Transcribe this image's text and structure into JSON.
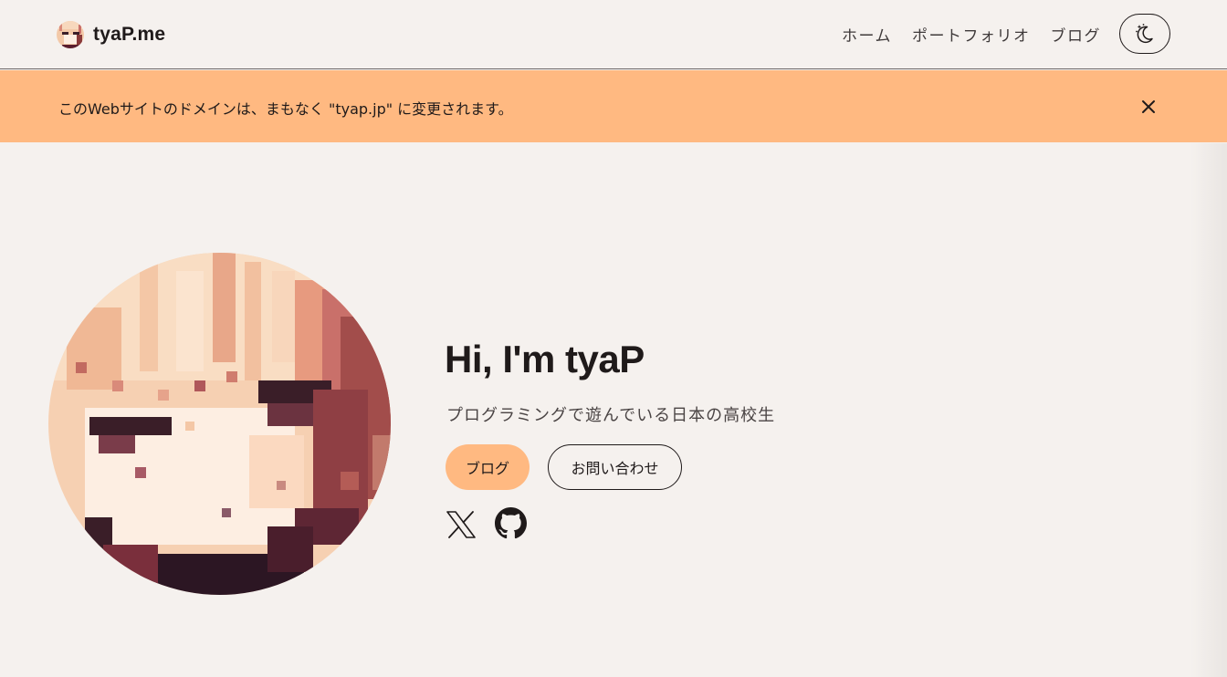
{
  "header": {
    "brand": "tyaP.me",
    "nav": [
      {
        "label": "ホーム"
      },
      {
        "label": "ポートフォリオ"
      },
      {
        "label": "ブログ"
      }
    ],
    "theme_icon": "moon-stars-icon"
  },
  "banner": {
    "message": "このWebサイトのドメインは、まもなく \"tyap.jp\" に変更されます。",
    "close_icon": "close-icon"
  },
  "hero": {
    "title": "Hi, I'm tyaP",
    "subtitle": "プログラミングで遊んでいる日本の高校生",
    "primary_button": "ブログ",
    "secondary_button": "お問い合わせ",
    "social_icons": [
      "x-icon",
      "github-icon"
    ]
  },
  "colors": {
    "background": "#f5f1ee",
    "accent": "#ffb981",
    "text": "#1f1a1a"
  }
}
